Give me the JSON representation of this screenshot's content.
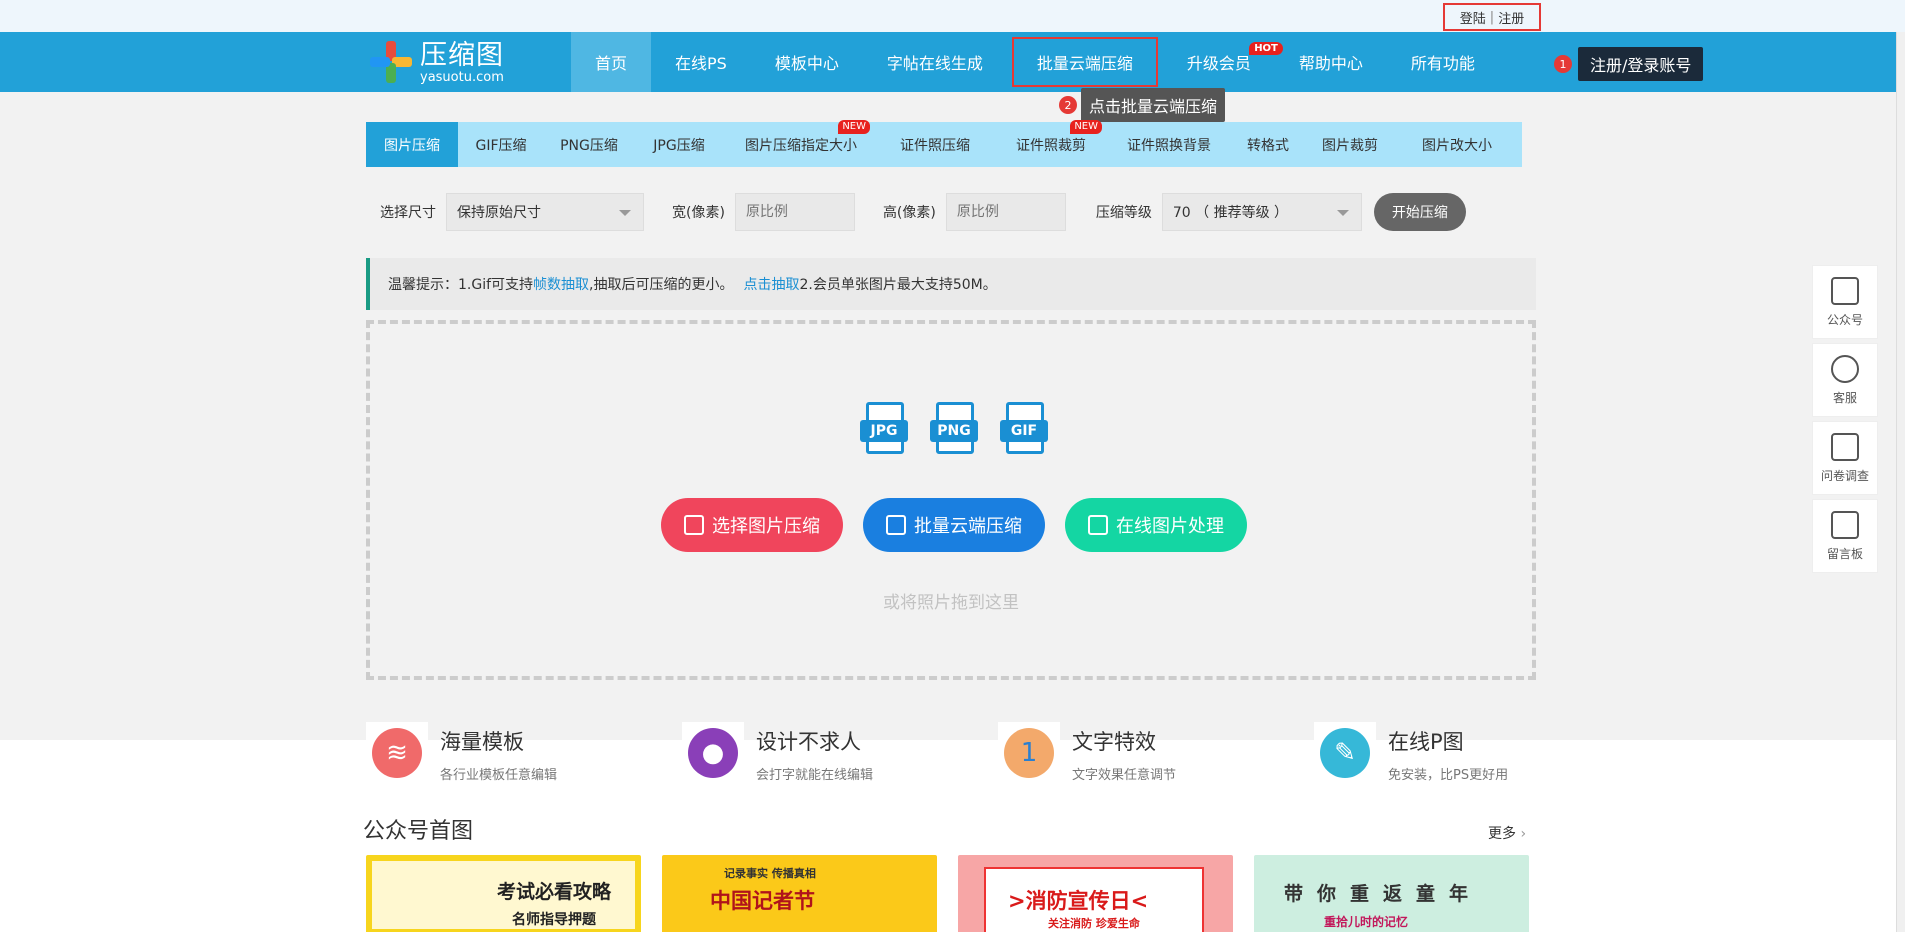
{
  "topbar": {
    "login": "登陆",
    "separator": "|",
    "register": "注册"
  },
  "header": {
    "logo_cn": "压缩图",
    "logo_en": "yasuotu.com",
    "nav": [
      {
        "label": "首页"
      },
      {
        "label": "在线PS"
      },
      {
        "label": "模板中心"
      },
      {
        "label": "字帖在线生成"
      },
      {
        "label": "批量云端压缩"
      },
      {
        "label": "升级会员",
        "badge": "HOT"
      },
      {
        "label": "帮助中心"
      },
      {
        "label": "所有功能"
      }
    ],
    "login_step": "1",
    "login_button": "注册/登录账号",
    "tooltip_step": "2",
    "tooltip": "点击批量云端压缩"
  },
  "category_tabs": [
    {
      "label": "图片压缩"
    },
    {
      "label": "GIF压缩"
    },
    {
      "label": "PNG压缩"
    },
    {
      "label": "JPG压缩"
    },
    {
      "label": "图片压缩指定大小",
      "badge": "NEW"
    },
    {
      "label": "证件照压缩"
    },
    {
      "label": "证件照裁剪",
      "badge": "NEW"
    },
    {
      "label": "证件照换背景"
    },
    {
      "label": "转格式"
    },
    {
      "label": "图片裁剪"
    },
    {
      "label": "图片改大小"
    }
  ],
  "options": {
    "size_label": "选择尺寸",
    "size_value": "保持原始尺寸",
    "width_label": "宽(像素)",
    "width_placeholder": "原比例",
    "height_label": "高(像素)",
    "height_placeholder": "原比例",
    "level_label": "压缩等级",
    "level_value": "70 （ 推荐等级 ）",
    "start_button": "开始压缩"
  },
  "notice": {
    "prefix": "温馨提示：1.Gif可支持",
    "link1": "帧数抽取",
    "middle": ",抽取后可压缩的更小。",
    "link2": "点击抽取",
    "suffix": " 2.会员单张图片最大支持50M。"
  },
  "dropzone": {
    "file_types": [
      "JPG",
      "PNG",
      "GIF"
    ],
    "select_button": "选择图片压缩",
    "batch_button": "批量云端压缩",
    "online_button": "在线图片处理",
    "hint": "或将照片拖到这里"
  },
  "features": [
    {
      "title": "海量模板",
      "subtitle": "各行业模板任意编辑",
      "color": "#f06a6a"
    },
    {
      "title": "设计不求人",
      "subtitle": "会打字就能在线编辑",
      "color": "#8a3fb8"
    },
    {
      "title": "文字特效",
      "subtitle": "文字效果任意调节",
      "color": "#f3a96b",
      "glyph": "1"
    },
    {
      "title": "在线P图",
      "subtitle": "免安装，比PS更好用",
      "color": "#36b8d8"
    }
  ],
  "section": {
    "title": "公众号首图",
    "more": "更多"
  },
  "cards": [
    {
      "text": "考试必看攻略",
      "sub": "名师指导押题"
    },
    {
      "text": "中国记者节",
      "sub": "记录事实 传播真相"
    },
    {
      "text": ">消防宣传日<",
      "sub": "关注消防 珍爱生命"
    },
    {
      "text": "带你重返童年",
      "sub": "重拾儿时的记忆"
    }
  ],
  "sidebar": [
    {
      "label": "公众号",
      "icon": "qrcode-icon"
    },
    {
      "label": "客服",
      "icon": "headset-icon"
    },
    {
      "label": "问卷调查",
      "icon": "clipboard-icon"
    },
    {
      "label": "留言板",
      "icon": "message-board-icon"
    }
  ]
}
